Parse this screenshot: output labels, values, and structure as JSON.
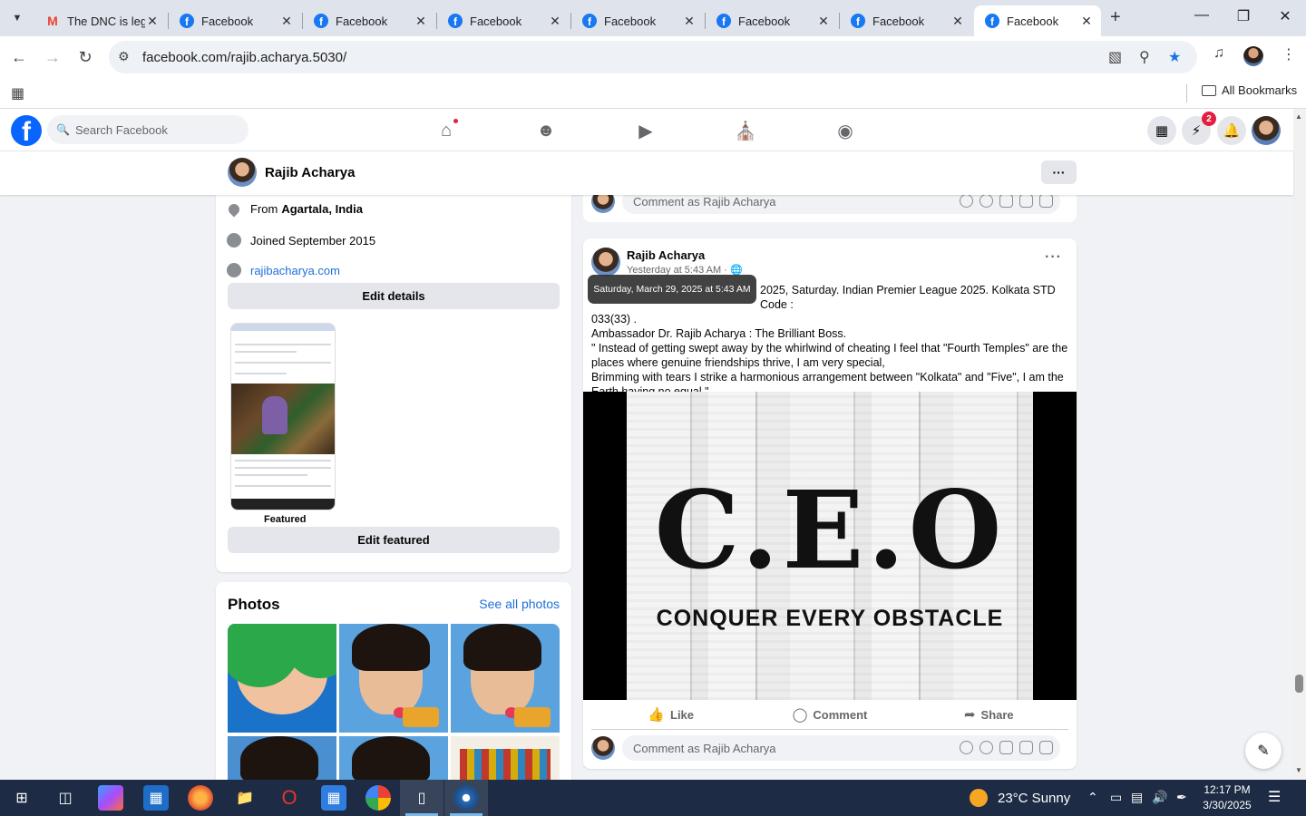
{
  "browser": {
    "tabs": [
      {
        "title": "The DNC is leg",
        "favicon": "gmail-icon",
        "active": false
      },
      {
        "title": "Facebook",
        "favicon": "facebook-icon",
        "active": false
      },
      {
        "title": "Facebook",
        "favicon": "facebook-icon",
        "active": false
      },
      {
        "title": "Facebook",
        "favicon": "facebook-icon",
        "active": false
      },
      {
        "title": "Facebook",
        "favicon": "facebook-icon",
        "active": false
      },
      {
        "title": "Facebook",
        "favicon": "facebook-icon",
        "active": false
      },
      {
        "title": "Facebook",
        "favicon": "facebook-icon",
        "active": false
      },
      {
        "title": "Facebook",
        "favicon": "facebook-icon",
        "active": true
      }
    ],
    "url": "facebook.com/rajib.acharya.5030/",
    "bookmarks_label": "All Bookmarks"
  },
  "facebook": {
    "search_placeholder": "Search Facebook",
    "messenger_badge": "2",
    "profile_name": "Rajib Acharya",
    "more_label": "···"
  },
  "intro": {
    "from_label": "From",
    "from_value": "Agartala, India",
    "joined": "Joined September 2015",
    "website": "rajibacharya.com",
    "edit_details": "Edit details",
    "featured_label": "Featured",
    "edit_featured": "Edit featured"
  },
  "photos": {
    "title": "Photos",
    "see_all": "See all photos"
  },
  "comment_placeholder": "Comment as Rajib Acharya",
  "post": {
    "author": "Rajib Acharya",
    "time": "Yesterday at 5:43 AM ·",
    "tooltip": "Saturday, March 29, 2025 at 5:43 AM",
    "line1": "2025, Saturday. Indian Premier League 2025. Kolkata STD Code :",
    "line2": "033(33) .",
    "line3": "Ambassador Dr. Rajib Acharya : The Brilliant Boss.",
    "line4": "\" Instead of getting swept away by the whirlwind of cheating I feel that \"Fourth Temples\" are the",
    "line5": "places where genuine friendships thrive, I am very special,",
    "line6": "Brimming with tears I strike a harmonious arrangement between \"Kolkata\" and \"Five\", I am the",
    "line7": "Earth having no equal.\"",
    "image_title": "C.E.O",
    "image_subtitle": "CONQUER EVERY OBSTACLE",
    "like": "Like",
    "comment": "Comment",
    "share": "Share"
  },
  "taskbar": {
    "weather": "23°C  Sunny",
    "time": "12:17 PM",
    "date": "3/30/2025"
  }
}
